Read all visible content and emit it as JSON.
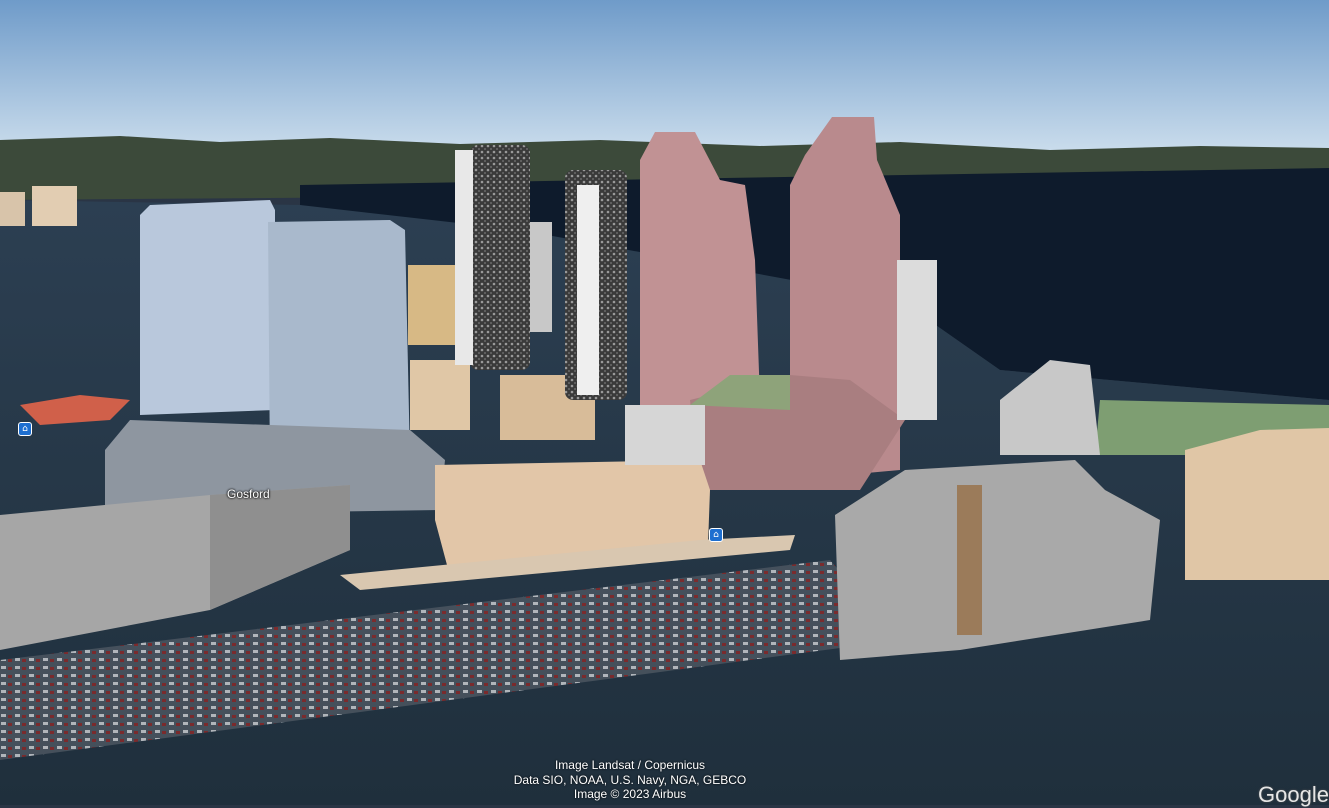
{
  "map": {
    "place_label": "Gosford",
    "transit_icon": "train-station-icon",
    "attribution": [
      "Image Landsat / Copernicus",
      "Data SIO, NOAA, U.S. Navy, NGA, GEBCO",
      "Image © 2023 Airbus"
    ],
    "logo_text": "Google",
    "colors": {
      "sky_top": "#6f9bc9",
      "sky_horizon": "#cfe0ee",
      "water": "#0e1b2c",
      "pink_tower": "#c19294",
      "blue_tower": "#b9c8dc",
      "beige_building": "#e2c6a8",
      "grey_building": "#a9a9a9"
    }
  }
}
